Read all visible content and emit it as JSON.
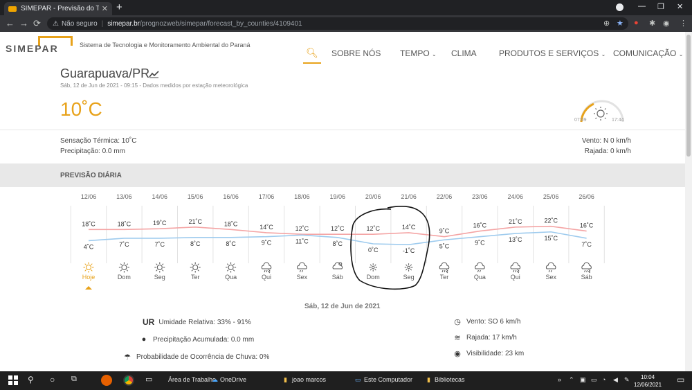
{
  "browser": {
    "tab_title": "SIMEPAR - Previsão do Tempo - ",
    "not_secure": "Não seguro",
    "url_domain": "simepar.br",
    "url_path": "/prognozweb/simepar/forecast_by_counties/4109401"
  },
  "site": {
    "logo": "SIMEPAR",
    "tagline": "Sistema de Tecnologia e Monitoramento Ambiental do Paraná",
    "nav": [
      "SOBRE NÓS",
      "TEMPO",
      "CLIMA",
      "PRODUTOS E SERVIÇOS",
      "COMUNICAÇÃO"
    ]
  },
  "current": {
    "city": "Guarapuava/PR",
    "observed": "Sáb, 12 de Jun de 2021 - 09:15 - Dados medidos por estação meteorológica",
    "temperature": "10˚C",
    "sunrise": "07:09",
    "sunset": "17:44",
    "feels_like": "Sensação Térmica: 10˚C",
    "precipitation": "Precipitação: 0.0 mm",
    "wind": "Vento: N 0 km/h",
    "gust": "Rajada: 0 km/h"
  },
  "daily": {
    "title": "PREVISÃO DIÁRIA",
    "dates": [
      "12/06",
      "13/06",
      "14/06",
      "15/06",
      "16/06",
      "17/06",
      "18/06",
      "19/06",
      "20/06",
      "21/06",
      "22/06",
      "23/06",
      "24/06",
      "25/06",
      "26/06"
    ],
    "max": [
      18,
      18,
      19,
      21,
      18,
      14,
      12,
      12,
      12,
      14,
      9,
      16,
      21,
      22,
      16
    ],
    "min": [
      4,
      7,
      7,
      8,
      8,
      9,
      11,
      8,
      0,
      -1,
      5,
      9,
      13,
      15,
      7
    ],
    "days": [
      "Hoje",
      "Dom",
      "Seg",
      "Ter",
      "Qua",
      "Qui",
      "Sex",
      "Sáb",
      "Dom",
      "Seg",
      "Ter",
      "Qua",
      "Qui",
      "Sex",
      "Sáb"
    ],
    "icons": [
      "sun-icon",
      "sun-icon",
      "sun-icon",
      "sun-icon",
      "sun-icon",
      "storm-icon",
      "rain-icon",
      "partly-cloudy-icon",
      "clear-night-icon",
      "clear-night-icon",
      "storm-icon",
      "rain-icon",
      "storm-icon",
      "rain-icon",
      "storm-icon"
    ],
    "max_color": "#f4a4a4",
    "min_color": "#9ecbee",
    "accent": "#e8a21a"
  },
  "details": {
    "date": "Sáb, 12 de Jun de 2021",
    "ur_label": "UR",
    "humidity": "Umidade Relativa: 33% - 91%",
    "precip_acc": "Precipitação Acumulada: 0.0 mm",
    "rain_prob": "Probabilidade de Ocorrência de Chuva: 0%",
    "wind": "Vento: SO 6 km/h",
    "gust": "Rajada: 17 km/h",
    "visibility": "Visibilidade: 23 km"
  },
  "taskbar": {
    "desktop": "Área de Trabalho",
    "onedrive": "OneDrive",
    "user": "joao marcos",
    "computer": "Este Computador",
    "libraries": "Bibliotecas",
    "time": "10:04",
    "date": "12/06/2021"
  }
}
